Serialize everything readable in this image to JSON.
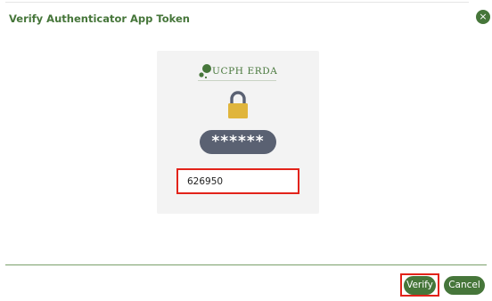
{
  "dialog": {
    "title": "Verify Authenticator App Token",
    "close_label": "×"
  },
  "card": {
    "logo_text": "UCPH ERDA",
    "password_mask": "******",
    "token_input": {
      "value": "626950",
      "placeholder": ""
    }
  },
  "footer": {
    "verify_label": "Verify",
    "cancel_label": "Cancel"
  },
  "colors": {
    "brand_green": "#46763a",
    "highlight_red": "#e2231a",
    "lock_gold": "#e0b53c",
    "pill_slate": "#5a6172"
  },
  "icons": [
    "close-icon",
    "ucph-logo-icon",
    "padlock-icon"
  ]
}
